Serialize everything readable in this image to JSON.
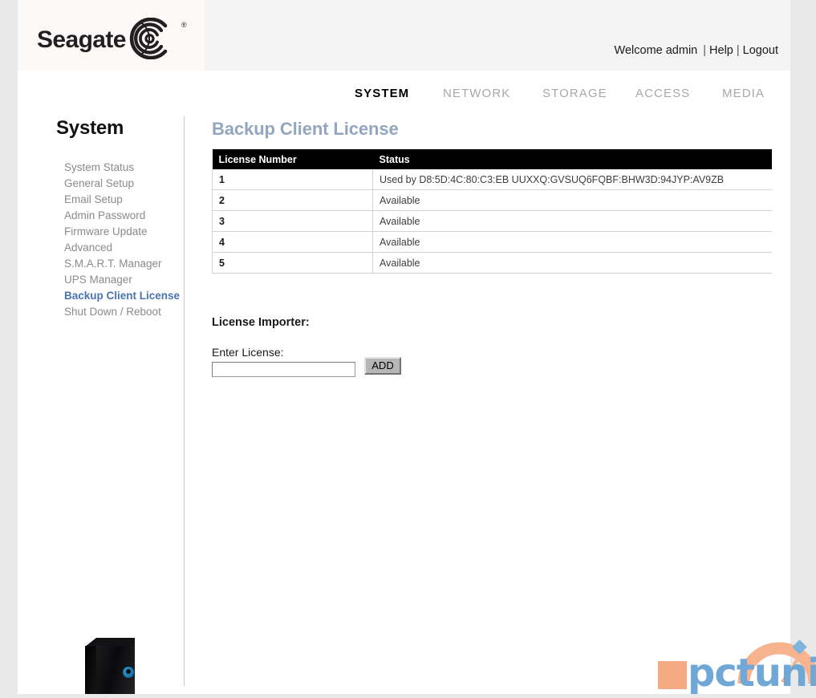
{
  "header": {
    "brand": "Seagate",
    "registered_mark": "®",
    "welcome": "Welcome admin",
    "separator": "|",
    "help": "Help",
    "logout": "Logout"
  },
  "nav": {
    "items": [
      {
        "label": "SYSTEM",
        "active": true
      },
      {
        "label": "NETWORK",
        "active": false
      },
      {
        "label": "STORAGE",
        "active": false
      },
      {
        "label": "ACCESS",
        "active": false
      },
      {
        "label": "MEDIA",
        "active": false
      }
    ]
  },
  "sidebar": {
    "title": "System",
    "items": [
      {
        "label": "System Status",
        "active": false
      },
      {
        "label": "General Setup",
        "active": false
      },
      {
        "label": "Email Setup",
        "active": false
      },
      {
        "label": "Admin Password",
        "active": false
      },
      {
        "label": "Firmware Update",
        "active": false
      },
      {
        "label": "Advanced",
        "active": false
      },
      {
        "label": "S.M.A.R.T. Manager",
        "active": false
      },
      {
        "label": "UPS Manager",
        "active": false
      },
      {
        "label": "Backup Client License",
        "active": true
      },
      {
        "label": "Shut Down / Reboot",
        "active": false
      }
    ]
  },
  "main": {
    "page_title": "Backup Client License",
    "table": {
      "columns": [
        "License Number",
        "Status"
      ],
      "rows": [
        {
          "number": "1",
          "status": "Used by D8:5D:4C:80:C3:EB UUXXQ:GVSUQ6FQBF:BHW3D:94JYP:AV9ZB"
        },
        {
          "number": "2",
          "status": "Available"
        },
        {
          "number": "3",
          "status": "Available"
        },
        {
          "number": "4",
          "status": "Available"
        },
        {
          "number": "5",
          "status": "Available"
        }
      ]
    },
    "importer": {
      "heading": "License Importer:",
      "field_label": "Enter License:",
      "input_value": "",
      "input_placeholder": "",
      "add_label": "ADD"
    }
  },
  "watermark": {
    "text": "pctuning",
    "square_color": "#f4ab84",
    "text_color": "#6fa8d6",
    "arc_color": "#f7b38d",
    "needle_color": "#6fa8d6"
  },
  "theme": {
    "title_color": "#93a6c0",
    "active_link_color": "#4a74b5",
    "table_header_bg": "#000000",
    "page_bg": "#ffffff",
    "canvas_bg": "#e9e9e9"
  }
}
